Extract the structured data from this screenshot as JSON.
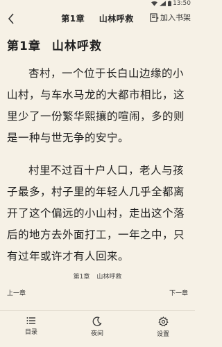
{
  "status": {
    "time": "13:50"
  },
  "header": {
    "chapter_num": "第1章",
    "chapter_name": "山林呼救",
    "add_to_shelf": "加入书架"
  },
  "content": {
    "heading_num": "第1章",
    "heading_name": "山林呼救",
    "paragraphs": [
      "杏村，一个位于长白山边缘的小山村，与车水马龙的大都市相比，这里少了一份繁华熙攘的喧闹，多的则是一种与世无争的安宁。",
      "村里不过百十户人口，老人与孩子最多，村子里的年轻人几乎全都离开了这个偏远的小山村，走出这个落后的地方去外面打工，一年之中，只有过年或许才有人回来。"
    ]
  },
  "footer": {
    "chapter_num": "第1章",
    "chapter_name": "山林呼救",
    "prev": "上一章",
    "next": "下一章"
  },
  "toolbar": {
    "menu": "目录",
    "night": "夜间",
    "settings": "设置"
  }
}
